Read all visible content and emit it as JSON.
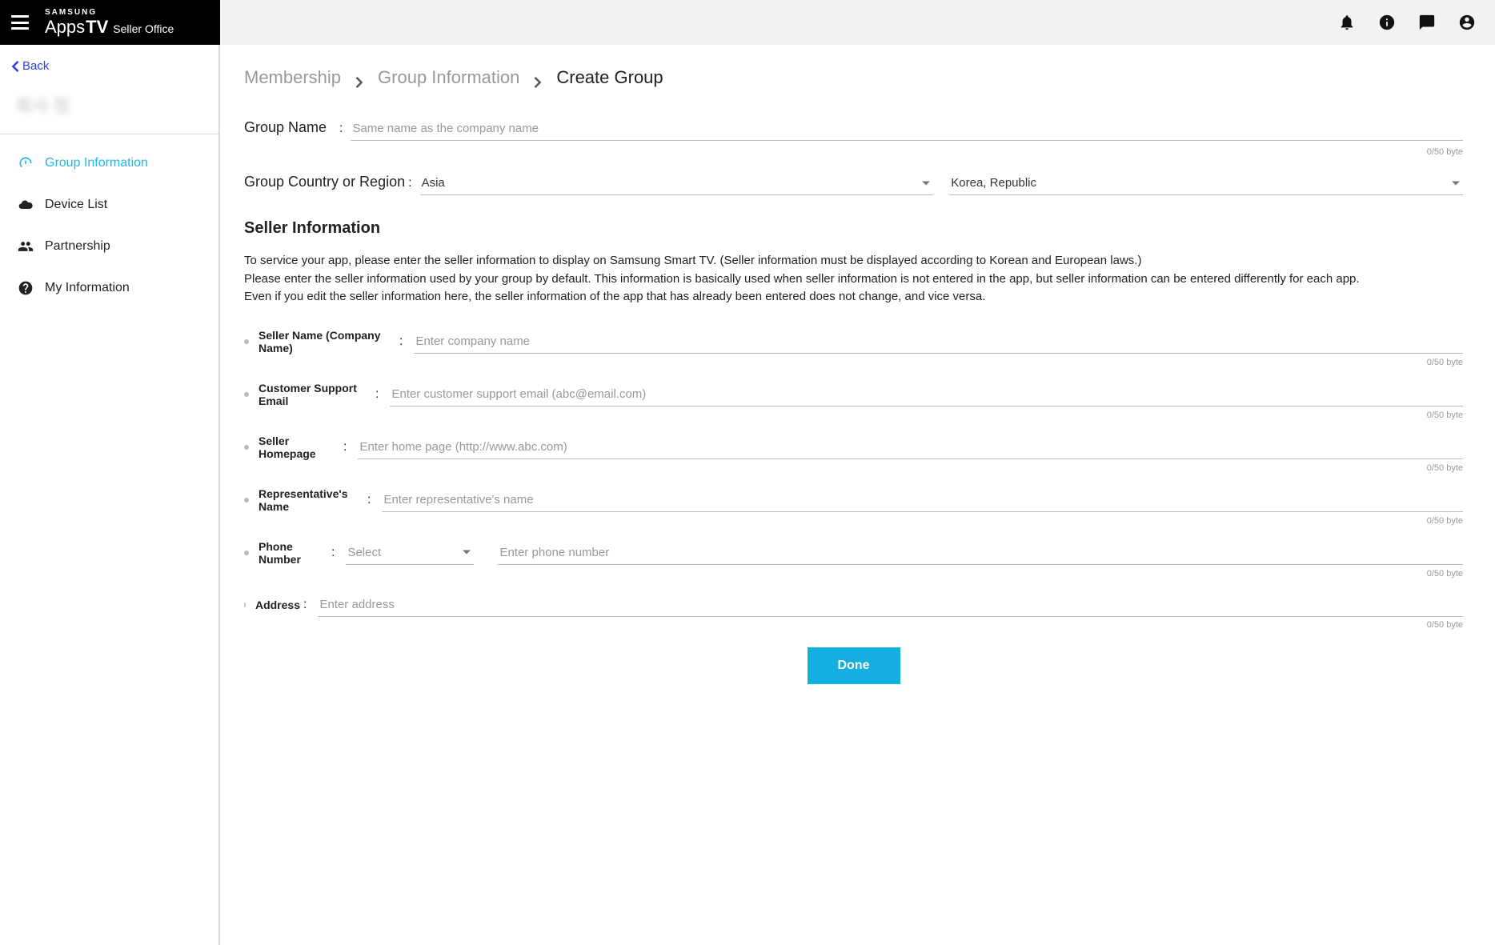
{
  "header": {
    "brand_samsung": "SAMSUNG",
    "brand_apps": "Apps",
    "brand_tv": "TV",
    "brand_suffix": "Seller Office"
  },
  "back": {
    "label": "Back"
  },
  "user_blur": "회사 정",
  "sidebar": {
    "items": [
      {
        "label": "Group Information"
      },
      {
        "label": "Device List"
      },
      {
        "label": "Partnership"
      },
      {
        "label": "My Information"
      }
    ]
  },
  "breadcrumb": {
    "items": [
      "Membership",
      "Group Information",
      "Create Group"
    ]
  },
  "form": {
    "group_name_label": "Group Name",
    "group_name_placeholder": "Same name as the company name",
    "group_name_counter": "0/50 byte",
    "group_region_label": "Group Country or Region",
    "region1_value": "Asia",
    "region2_value": "Korea, Republic",
    "seller_section_title": "Seller Information",
    "seller_info_text": "To service your app, please enter the seller information to display on Samsung Smart TV. (Seller information must be displayed according to Korean and European laws.)\nPlease enter the seller information used by your group by default. This information is basically used when seller information is not entered in the app, but seller information can be entered differently for each app.\nEven if you edit the seller information here, the seller information of the app that has already been entered does not change, and vice versa.",
    "seller_name_label": "Seller Name (Company Name)",
    "seller_name_placeholder": "Enter company name",
    "support_email_label": "Customer Support Email",
    "support_email_placeholder": "Enter customer support email (abc@email.com)",
    "homepage_label": "Seller Homepage",
    "homepage_placeholder": "Enter home page (http://www.abc.com)",
    "rep_name_label": "Representative's Name",
    "rep_name_placeholder": "Enter representative's name",
    "phone_label": "Phone Number",
    "phone_select_placeholder": "Select",
    "phone_placeholder": "Enter phone number",
    "address_label": "Address",
    "address_placeholder": "Enter address",
    "counter": "0/50 byte",
    "done_label": "Done"
  }
}
